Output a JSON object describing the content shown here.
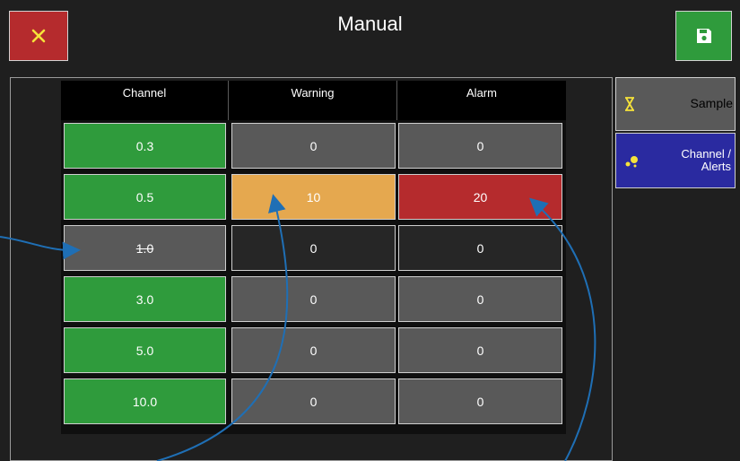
{
  "header": {
    "title": "Manual",
    "close_icon": "close-icon",
    "save_icon": "save-icon"
  },
  "table": {
    "columns": [
      "Channel",
      "Warning",
      "Alarm"
    ],
    "rows": [
      {
        "channel": "0.3",
        "warning": "0",
        "alarm": "0",
        "enabled": true
      },
      {
        "channel": "0.5",
        "warning": "10",
        "alarm": "20",
        "enabled": true
      },
      {
        "channel": "1.0",
        "warning": "0",
        "alarm": "0",
        "enabled": false
      },
      {
        "channel": "3.0",
        "warning": "0",
        "alarm": "0",
        "enabled": true
      },
      {
        "channel": "5.0",
        "warning": "0",
        "alarm": "0",
        "enabled": true
      },
      {
        "channel": "10.0",
        "warning": "0",
        "alarm": "0",
        "enabled": true
      }
    ]
  },
  "sidebar": {
    "sample": {
      "label": "Sample",
      "icon": "hourglass-icon"
    },
    "channel_alerts": {
      "label_line1": "Channel /",
      "label_line2": "Alerts",
      "icon": "dots-icon"
    }
  },
  "colors": {
    "green": "#2f9b3c",
    "red": "#b52b2d",
    "orange": "#e5a84f",
    "blue": "#2a2aa0",
    "annotation": "#1f6fb5"
  }
}
